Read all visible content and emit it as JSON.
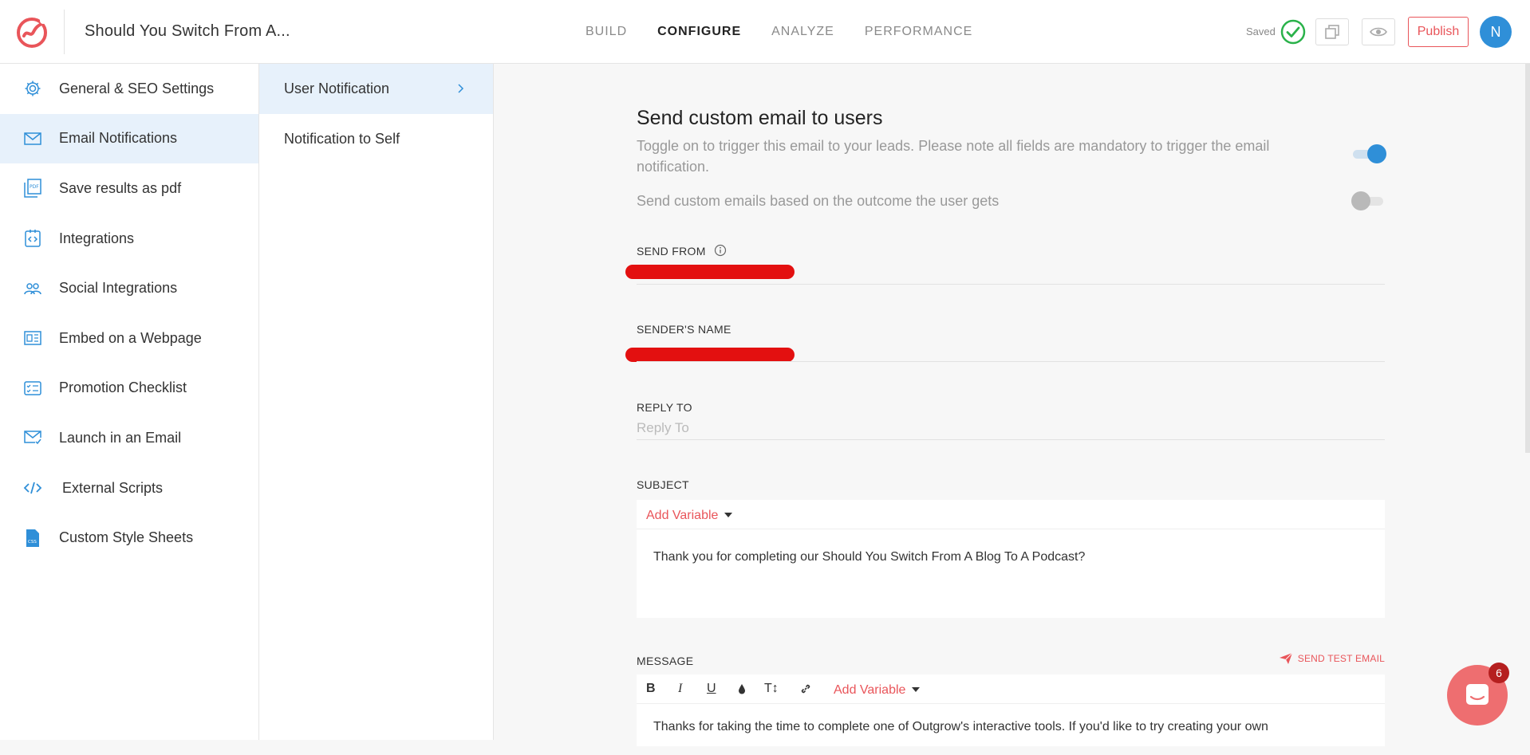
{
  "header": {
    "doc_title": "Should You Switch From A...",
    "tabs": [
      {
        "label": "BUILD"
      },
      {
        "label": "CONFIGURE"
      },
      {
        "label": "ANALYZE"
      },
      {
        "label": "PERFORMANCE"
      }
    ],
    "active_tab": "CONFIGURE",
    "saved_label": "Saved",
    "publish_label": "Publish",
    "avatar_initial": "N"
  },
  "sidebar": {
    "items": [
      {
        "label": "General & SEO Settings",
        "icon": "gear-icon"
      },
      {
        "label": "Email Notifications",
        "icon": "envelope-icon"
      },
      {
        "label": "Save results as pdf",
        "icon": "pdf-icon"
      },
      {
        "label": "Integrations",
        "icon": "integrations-icon"
      },
      {
        "label": "Social Integrations",
        "icon": "people-icon"
      },
      {
        "label": "Embed on a Webpage",
        "icon": "embed-icon"
      },
      {
        "label": "Promotion Checklist",
        "icon": "checklist-icon"
      },
      {
        "label": "Launch in an Email",
        "icon": "email-launch-icon"
      },
      {
        "label": "External Scripts",
        "icon": "code-icon"
      },
      {
        "label": "Custom Style Sheets",
        "icon": "css-file-icon"
      }
    ],
    "active_index": 1
  },
  "subnav": {
    "items": [
      {
        "label": "User Notification"
      },
      {
        "label": "Notification to Self"
      }
    ]
  },
  "main": {
    "title": "Send custom email to users",
    "description": "Toggle on to trigger this email to your leads. Please note all fields are mandatory to trigger the email notification.",
    "outcome_toggle_label": "Send custom emails based on the outcome the user gets",
    "toggle_main_on": true,
    "toggle_outcome_on": false,
    "send_from_label": "SEND FROM",
    "sender_name_label": "SENDER'S NAME",
    "reply_to_label": "REPLY TO",
    "reply_to_placeholder": "Reply To",
    "subject_label": "SUBJECT",
    "add_variable_label": "Add Variable",
    "subject_text": "Thank you for completing our Should You Switch From A Blog To A Podcast?",
    "message_label": "MESSAGE",
    "send_test_label": "SEND TEST EMAIL",
    "message_text": "Thanks for taking the time to complete one of Outgrow's interactive tools. If you'd like to try creating your own",
    "toolbar": {
      "bold": "B",
      "italic": "I",
      "underline": "U",
      "font_size": "T↕"
    }
  },
  "chat": {
    "badge_count": "6"
  },
  "colors": {
    "accent_red": "#e9555a",
    "accent_blue": "#2f8fd8",
    "active_bg": "#e7f1fb",
    "redaction": "#e31010"
  }
}
